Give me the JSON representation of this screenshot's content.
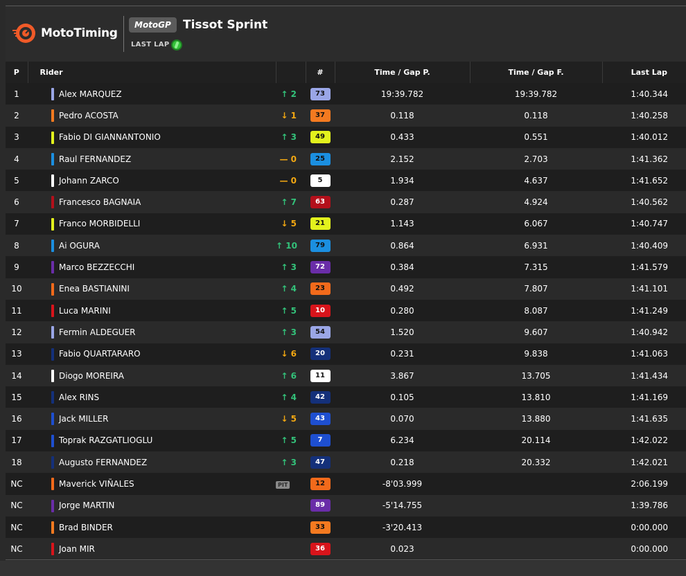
{
  "brand": {
    "name": "MotoTiming",
    "accent": "#f05a28"
  },
  "session": {
    "series": "MotoGP",
    "title": "Tissot Sprint",
    "last_lap_label": "LAST LAP",
    "tyre_icon": "green-tyre-icon"
  },
  "columns": {
    "pos": "P",
    "rider": "Rider",
    "num": "#",
    "gap_prev": "Time / Gap P.",
    "gap_first": "Time / Gap F.",
    "last_lap": "Last Lap"
  },
  "rows": [
    {
      "pos": "1",
      "rider": "Alex MARQUEZ",
      "team_color": "#9aa6e6",
      "change": "↑ 2",
      "dir": "up",
      "num": "73",
      "badge_bg": "#9aa6e6",
      "badge_fg": "#111111",
      "gap_prev": "19:39.782",
      "gap_first": "19:39.782",
      "last_lap": "1:40.344"
    },
    {
      "pos": "2",
      "rider": "Pedro ACOSTA",
      "team_color": "#f47a20",
      "change": "↓ 1",
      "dir": "down",
      "num": "37",
      "badge_bg": "#f47a20",
      "badge_fg": "#111111",
      "gap_prev": "0.118",
      "gap_first": "0.118",
      "last_lap": "1:40.258"
    },
    {
      "pos": "3",
      "rider": "Fabio DI GIANNANTONIO",
      "team_color": "#e3f21d",
      "change": "↑ 3",
      "dir": "up",
      "num": "49",
      "badge_bg": "#e3f21d",
      "badge_fg": "#111111",
      "gap_prev": "0.433",
      "gap_first": "0.551",
      "last_lap": "1:40.012"
    },
    {
      "pos": "4",
      "rider": "Raul FERNANDEZ",
      "team_color": "#1b8fe0",
      "change": "— 0",
      "dir": "same",
      "num": "25",
      "badge_bg": "#1b8fe0",
      "badge_fg": "#111111",
      "gap_prev": "2.152",
      "gap_first": "2.703",
      "last_lap": "1:41.362"
    },
    {
      "pos": "5",
      "rider": "Johann ZARCO",
      "team_color": "#ffffff",
      "change": "— 0",
      "dir": "same",
      "num": "5",
      "badge_bg": "#ffffff",
      "badge_fg": "#111111",
      "gap_prev": "1.934",
      "gap_first": "4.637",
      "last_lap": "1:41.652"
    },
    {
      "pos": "6",
      "rider": "Francesco BAGNAIA",
      "team_color": "#b3101b",
      "change": "↑ 7",
      "dir": "up",
      "num": "63",
      "badge_bg": "#b3101b",
      "badge_fg": "#ffffff",
      "gap_prev": "0.287",
      "gap_first": "4.924",
      "last_lap": "1:40.562"
    },
    {
      "pos": "7",
      "rider": "Franco MORBIDELLI",
      "team_color": "#e3f21d",
      "change": "↓ 5",
      "dir": "down",
      "num": "21",
      "badge_bg": "#e3f21d",
      "badge_fg": "#111111",
      "gap_prev": "1.143",
      "gap_first": "6.067",
      "last_lap": "1:40.747"
    },
    {
      "pos": "8",
      "rider": "Ai OGURA",
      "team_color": "#1b8fe0",
      "change": "↑ 10",
      "dir": "up",
      "num": "79",
      "badge_bg": "#1b8fe0",
      "badge_fg": "#111111",
      "gap_prev": "0.864",
      "gap_first": "6.931",
      "last_lap": "1:40.409"
    },
    {
      "pos": "9",
      "rider": "Marco BEZZECCHI",
      "team_color": "#6a2da8",
      "change": "↑ 3",
      "dir": "up",
      "num": "72",
      "badge_bg": "#6a2da8",
      "badge_fg": "#ffffff",
      "gap_prev": "0.384",
      "gap_first": "7.315",
      "last_lap": "1:41.579"
    },
    {
      "pos": "10",
      "rider": "Enea BASTIANINI",
      "team_color": "#f26a1b",
      "change": "↑ 4",
      "dir": "up",
      "num": "23",
      "badge_bg": "#f26a1b",
      "badge_fg": "#111111",
      "gap_prev": "0.492",
      "gap_first": "7.807",
      "last_lap": "1:41.101"
    },
    {
      "pos": "11",
      "rider": "Luca MARINI",
      "team_color": "#d8141b",
      "change": "↑ 5",
      "dir": "up",
      "num": "10",
      "badge_bg": "#d8141b",
      "badge_fg": "#ffffff",
      "gap_prev": "0.280",
      "gap_first": "8.087",
      "last_lap": "1:41.249"
    },
    {
      "pos": "12",
      "rider": "Fermin ALDEGUER",
      "team_color": "#9aa6e6",
      "change": "↑ 3",
      "dir": "up",
      "num": "54",
      "badge_bg": "#9aa6e6",
      "badge_fg": "#111111",
      "gap_prev": "1.520",
      "gap_first": "9.607",
      "last_lap": "1:40.942"
    },
    {
      "pos": "13",
      "rider": "Fabio QUARTARARO",
      "team_color": "#14307a",
      "change": "↓ 6",
      "dir": "down",
      "num": "20",
      "badge_bg": "#14307a",
      "badge_fg": "#ffffff",
      "gap_prev": "0.231",
      "gap_first": "9.838",
      "last_lap": "1:41.063"
    },
    {
      "pos": "14",
      "rider": "Diogo MOREIRA",
      "team_color": "#ffffff",
      "change": "↑ 6",
      "dir": "up",
      "num": "11",
      "badge_bg": "#ffffff",
      "badge_fg": "#111111",
      "gap_prev": "3.867",
      "gap_first": "13.705",
      "last_lap": "1:41.434"
    },
    {
      "pos": "15",
      "rider": "Alex RINS",
      "team_color": "#14307a",
      "change": "↑ 4",
      "dir": "up",
      "num": "42",
      "badge_bg": "#14307a",
      "badge_fg": "#ffffff",
      "gap_prev": "0.105",
      "gap_first": "13.810",
      "last_lap": "1:41.169"
    },
    {
      "pos": "16",
      "rider": "Jack MILLER",
      "team_color": "#1e4fd0",
      "change": "↓ 5",
      "dir": "down",
      "num": "43",
      "badge_bg": "#1e4fd0",
      "badge_fg": "#ffffff",
      "gap_prev": "0.070",
      "gap_first": "13.880",
      "last_lap": "1:41.635"
    },
    {
      "pos": "17",
      "rider": "Toprak RAZGATLIOGLU",
      "team_color": "#1e4fd0",
      "change": "↑ 5",
      "dir": "up",
      "num": "7",
      "badge_bg": "#1e4fd0",
      "badge_fg": "#ffffff",
      "gap_prev": "6.234",
      "gap_first": "20.114",
      "last_lap": "1:42.022"
    },
    {
      "pos": "18",
      "rider": "Augusto FERNANDEZ",
      "team_color": "#14307a",
      "change": "↑ 3",
      "dir": "up",
      "num": "47",
      "badge_bg": "#14307a",
      "badge_fg": "#ffffff",
      "gap_prev": "0.218",
      "gap_first": "20.332",
      "last_lap": "1:42.021"
    },
    {
      "pos": "NC",
      "rider": "Maverick VIÑALES",
      "team_color": "#f26a1b",
      "change": "",
      "dir": "",
      "pit": "PIT",
      "num": "12",
      "badge_bg": "#f26a1b",
      "badge_fg": "#111111",
      "gap_prev": "-8'03.999",
      "gap_first": "",
      "last_lap": "2:06.199"
    },
    {
      "pos": "NC",
      "rider": "Jorge MARTIN",
      "team_color": "#6a2da8",
      "change": "",
      "dir": "",
      "num": "89",
      "badge_bg": "#6a2da8",
      "badge_fg": "#ffffff",
      "gap_prev": "-5'14.755",
      "gap_first": "",
      "last_lap": "1:39.786"
    },
    {
      "pos": "NC",
      "rider": "Brad BINDER",
      "team_color": "#f47a20",
      "change": "",
      "dir": "",
      "num": "33",
      "badge_bg": "#f47a20",
      "badge_fg": "#111111",
      "gap_prev": "-3'20.413",
      "gap_first": "",
      "last_lap": "0:00.000"
    },
    {
      "pos": "NC",
      "rider": "Joan MIR",
      "team_color": "#d8141b",
      "change": "",
      "dir": "",
      "num": "36",
      "badge_bg": "#d8141b",
      "badge_fg": "#ffffff",
      "gap_prev": "0.023",
      "gap_first": "",
      "last_lap": "0:00.000"
    }
  ]
}
